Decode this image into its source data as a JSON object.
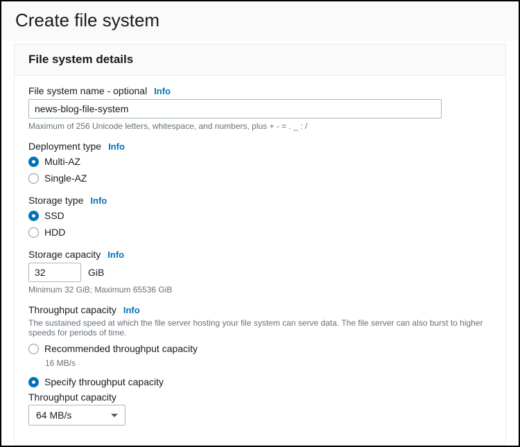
{
  "page": {
    "title": "Create file system"
  },
  "panel": {
    "title": "File system details"
  },
  "info_label": "Info",
  "name": {
    "label": "File system name - optional",
    "value": "news-blog-file-system",
    "hint": "Maximum of 256 Unicode letters, whitespace, and numbers, plus + - = . _ : /"
  },
  "deployment": {
    "label": "Deployment type",
    "options": [
      "Multi-AZ",
      "Single-AZ"
    ],
    "selected": "Multi-AZ"
  },
  "storage_type": {
    "label": "Storage type",
    "options": [
      "SSD",
      "HDD"
    ],
    "selected": "SSD"
  },
  "capacity": {
    "label": "Storage capacity",
    "value": "32",
    "unit": "GiB",
    "hint": "Minimum 32 GiB; Maximum 65536 GiB"
  },
  "throughput": {
    "label": "Throughput capacity",
    "desc": "The sustained speed at which the file server hosting your file system can serve data. The file server can also burst to higher speeds for periods of time.",
    "options": {
      "recommended": {
        "label": "Recommended throughput capacity",
        "sub": "16 MB/s"
      },
      "specify": {
        "label": "Specify throughput capacity"
      }
    },
    "selected": "specify",
    "select_label": "Throughput capacity",
    "select_value": "64 MB/s"
  }
}
